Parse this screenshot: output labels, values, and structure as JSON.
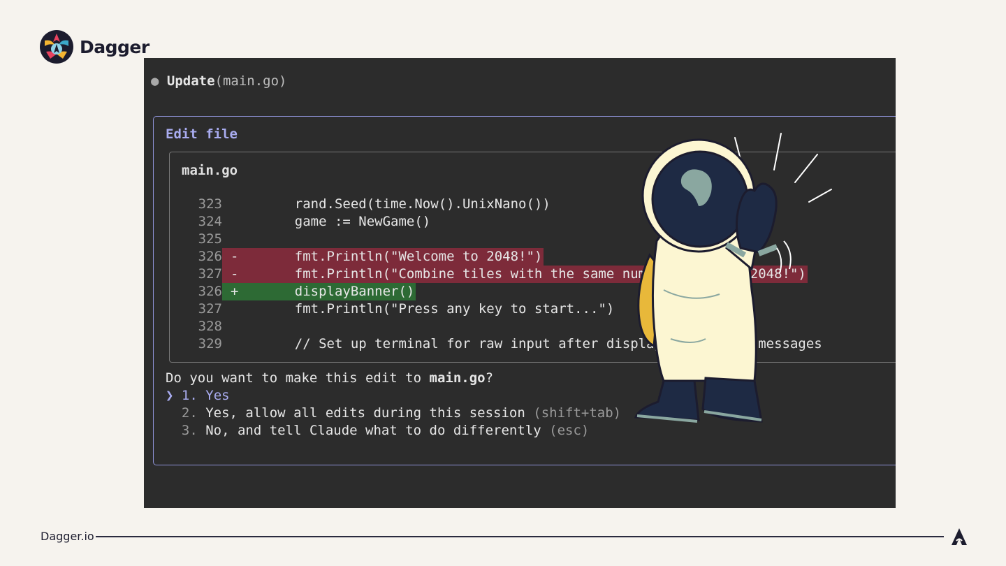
{
  "brand": {
    "name": "Dagger",
    "logo_icon": "dagger-logo-icon"
  },
  "terminal": {
    "update_label": "Update",
    "update_arg": "(main.go)",
    "edit_title": "Edit file",
    "file_name": "main.go",
    "lines": [
      {
        "num": "323",
        "sign": "",
        "code": "    rand.Seed(time.Now().UnixNano())",
        "type": "context"
      },
      {
        "num": "324",
        "sign": "",
        "code": "    game := NewGame()",
        "type": "context"
      },
      {
        "num": "325",
        "sign": "",
        "code": "",
        "type": "context"
      },
      {
        "num": "326",
        "sign": "-",
        "code": "    fmt.Println(\"Welcome to 2048!\")",
        "type": "del"
      },
      {
        "num": "327",
        "sign": "-",
        "code": "    fmt.Println(\"Combine tiles with the same number to reach 2048!\")",
        "type": "del"
      },
      {
        "num": "326",
        "sign": "+",
        "code": "    displayBanner()",
        "type": "add"
      },
      {
        "num": "327",
        "sign": "",
        "code": "    fmt.Println(\"Press any key to start...\")",
        "type": "context"
      },
      {
        "num": "328",
        "sign": "",
        "code": "",
        "type": "context"
      },
      {
        "num": "329",
        "sign": "",
        "code": "    // Set up terminal for raw input after displaying welcome messages",
        "type": "context"
      }
    ],
    "question_prefix": "Do you want to make this edit to ",
    "question_file": "main.go",
    "question_suffix": "?",
    "options": [
      {
        "cursor": "❯",
        "num": "1.",
        "label": "Yes",
        "hint": ""
      },
      {
        "cursor": "",
        "num": "2.",
        "label": "Yes, allow all edits during this session",
        "hint": "(shift+tab)"
      },
      {
        "cursor": "",
        "num": "3.",
        "label": "No, and tell Claude what to do differently",
        "hint": "(esc)"
      }
    ]
  },
  "mascot_icon": "astronaut-illustration",
  "footer": {
    "site": "Dagger.io",
    "logo_icon": "dagger-mark-icon"
  },
  "colors": {
    "background": "#f6f3ee",
    "terminal": "#2c2c2c",
    "accent": "#a9acf0",
    "deleted": "#7d2b3a",
    "added": "#2d6a34"
  }
}
